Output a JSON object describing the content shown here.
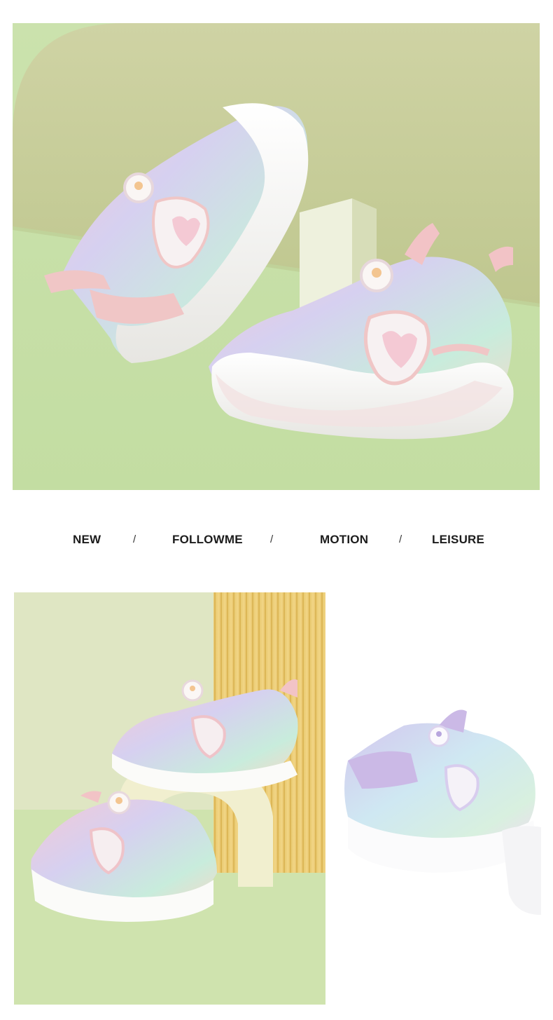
{
  "tagline": {
    "words": [
      "NEW",
      "FOLLOWME",
      "MOTION",
      "LEISURE"
    ],
    "separator": "/"
  },
  "shoe_branding": "Followme",
  "colors": {
    "hero_wall": "#c9cf9d",
    "hero_floor": "#c7e0a9",
    "shoe_white": "#f6f4f2",
    "shoe_pink": "#f0c6c6",
    "shoe_lilac": "#cbb9e6",
    "accent_mint": "#7ecfb8",
    "wood_yellow": "#e9c567",
    "panel_bg": "#dde6c1"
  },
  "images": [
    {
      "id": "hero",
      "subject": "two-pink-sneakers-on-pedestal"
    },
    {
      "id": "detail-left",
      "subject": "two-pink-sneakers-on-arch"
    },
    {
      "id": "detail-right",
      "subject": "lilac-sneaker"
    }
  ]
}
